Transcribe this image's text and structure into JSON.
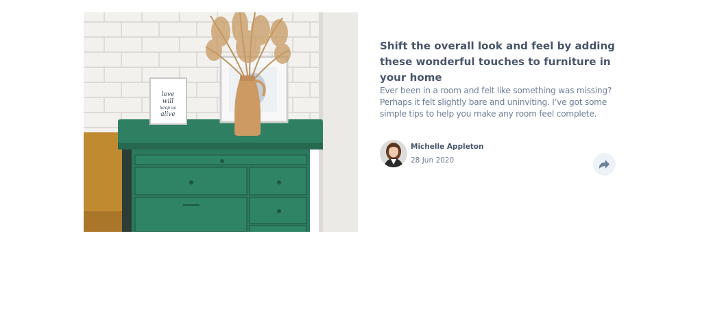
{
  "article": {
    "image_alt": "Green dresser with vase of dried grass and framed prints",
    "title": "Shift the overall look and feel by adding these wonderful touches to furniture in your home",
    "description": "Ever been in a room and felt like something was missing? Perhaps it felt slightly bare and uninviting. I’ve got some simple tips to help you make any room feel complete."
  },
  "author": {
    "name": "Michelle Appleton",
    "date": "28 Jun 2020"
  },
  "share": {
    "icon": "share-icon",
    "label": "Share"
  },
  "colors": {
    "heading": "#48556a",
    "body_text": "#6e8098",
    "share_bg": "#ecf2f8",
    "share_icon": "#6e8098",
    "dresser": "#2e7d62"
  }
}
